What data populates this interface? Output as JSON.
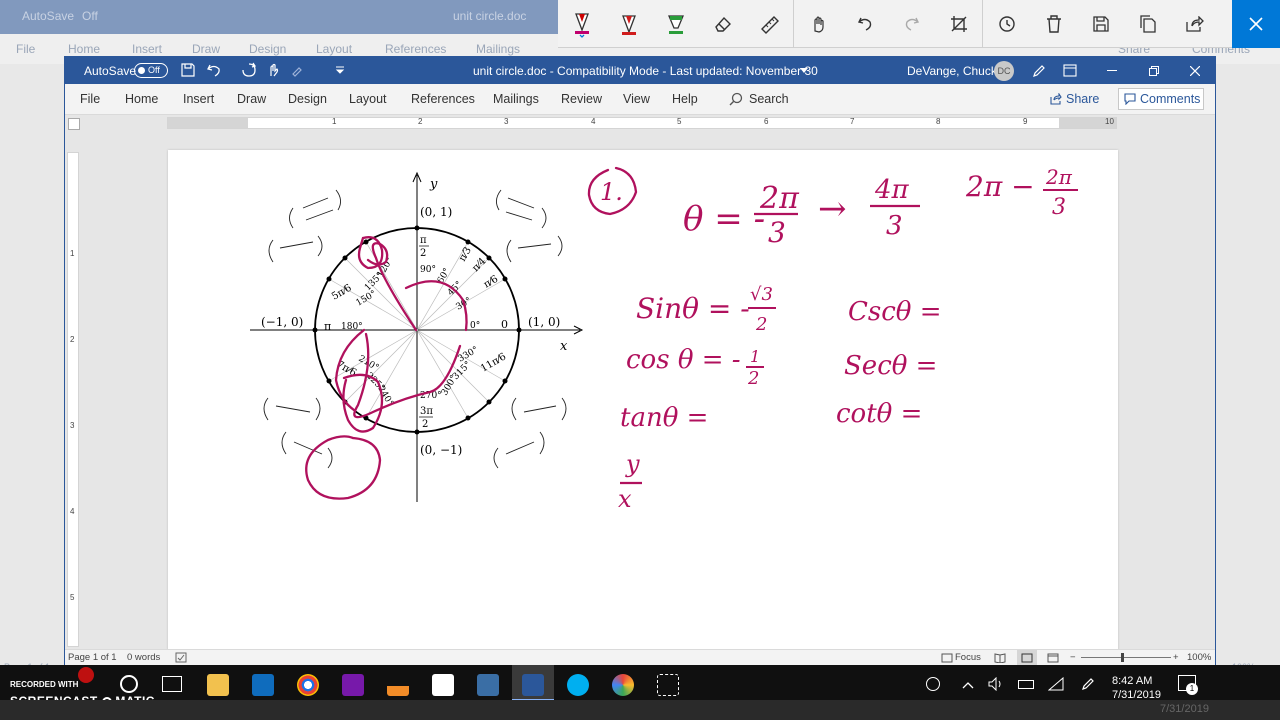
{
  "background_window": {
    "autosave": "AutoSave",
    "toggle": "Off",
    "title": "unit circle.doc",
    "menu": [
      "File",
      "Home",
      "Insert",
      "Draw",
      "Design",
      "Layout",
      "References",
      "Mailings",
      "Review",
      "View",
      "Help",
      "Search"
    ],
    "share": "Share",
    "comments": "Comments",
    "status": "Page 1 of 1",
    "zoom": "100%"
  },
  "titlebar": {
    "autosave_label": "AutoSave",
    "toggle_state": "Off",
    "document_title": "unit circle.doc  -  Compatibility Mode  -  Last updated: November 30",
    "user_name": "DeVange, Chuck",
    "user_initials": "DC"
  },
  "menu": {
    "items": [
      "File",
      "Home",
      "Insert",
      "Draw",
      "Design",
      "Layout",
      "References",
      "Mailings",
      "Review",
      "View",
      "Help"
    ],
    "search_label": "Search",
    "share_label": "Share",
    "comments_label": "Comments"
  },
  "ruler": {
    "numbers": [
      "1",
      "2",
      "3",
      "4",
      "5",
      "6",
      "7",
      "8",
      "9",
      "10"
    ],
    "vertical_numbers": [
      "1",
      "2",
      "3",
      "4",
      "5"
    ]
  },
  "diagram": {
    "y_axis": "y",
    "x_axis": "x",
    "points": {
      "top": "(0, 1)",
      "left": "(−1, 0)",
      "right": "(1, 0)",
      "bottom": "(0, −1)"
    },
    "radians": {
      "pi_half_num": "π",
      "pi_half_den": "2",
      "pi": "π",
      "zero": "0",
      "three_pi_half_num": "3π",
      "three_pi_half_den": "2"
    },
    "degrees": [
      "90°",
      "120°",
      "135°",
      "150°",
      "180°",
      "210°",
      "225°",
      "240°",
      "270°",
      "300°",
      "315°",
      "330°",
      "0°",
      "30°",
      "45°",
      "60°"
    ],
    "fractions": {
      "pi3": "π⁄3",
      "pi4": "π⁄4",
      "pi6": "π⁄6",
      "five_pi6": "5π⁄6",
      "seven_pi6": "7π⁄6",
      "eleven_pi6": "11π⁄6"
    }
  },
  "handwriting": {
    "problem_number": "1.",
    "theta_eq": "θ = -",
    "two_pi": "2π",
    "three": "3",
    "arrow": "→",
    "four_pi": "4π",
    "two_pi_minus": "2π −",
    "two_pi_small": "2π",
    "sin": "Sinθ = -",
    "sqrt3": "√3",
    "two": "2",
    "cos": "cos θ = -",
    "one": "1",
    "tan": "tanθ =",
    "csc": "Cscθ =",
    "sec": "Secθ =",
    "cot": "cotθ =",
    "y": "y",
    "x": "x"
  },
  "statusbar": {
    "page": "Page 1 of 1",
    "words": "0 words",
    "focus": "Focus",
    "zoom": "100%"
  },
  "taskbar": {
    "recorded_with": "RECORDED WITH",
    "brand_left": "SCREENCAST",
    "brand_right": "MATIC",
    "time": "8:42 AM",
    "date": "7/31/2019",
    "watermark_date": "7/31/2019",
    "notification_count": "1"
  },
  "colors": {
    "word_blue": "#2b579a",
    "ink": "#b0115d",
    "accent": "#0078d7"
  }
}
